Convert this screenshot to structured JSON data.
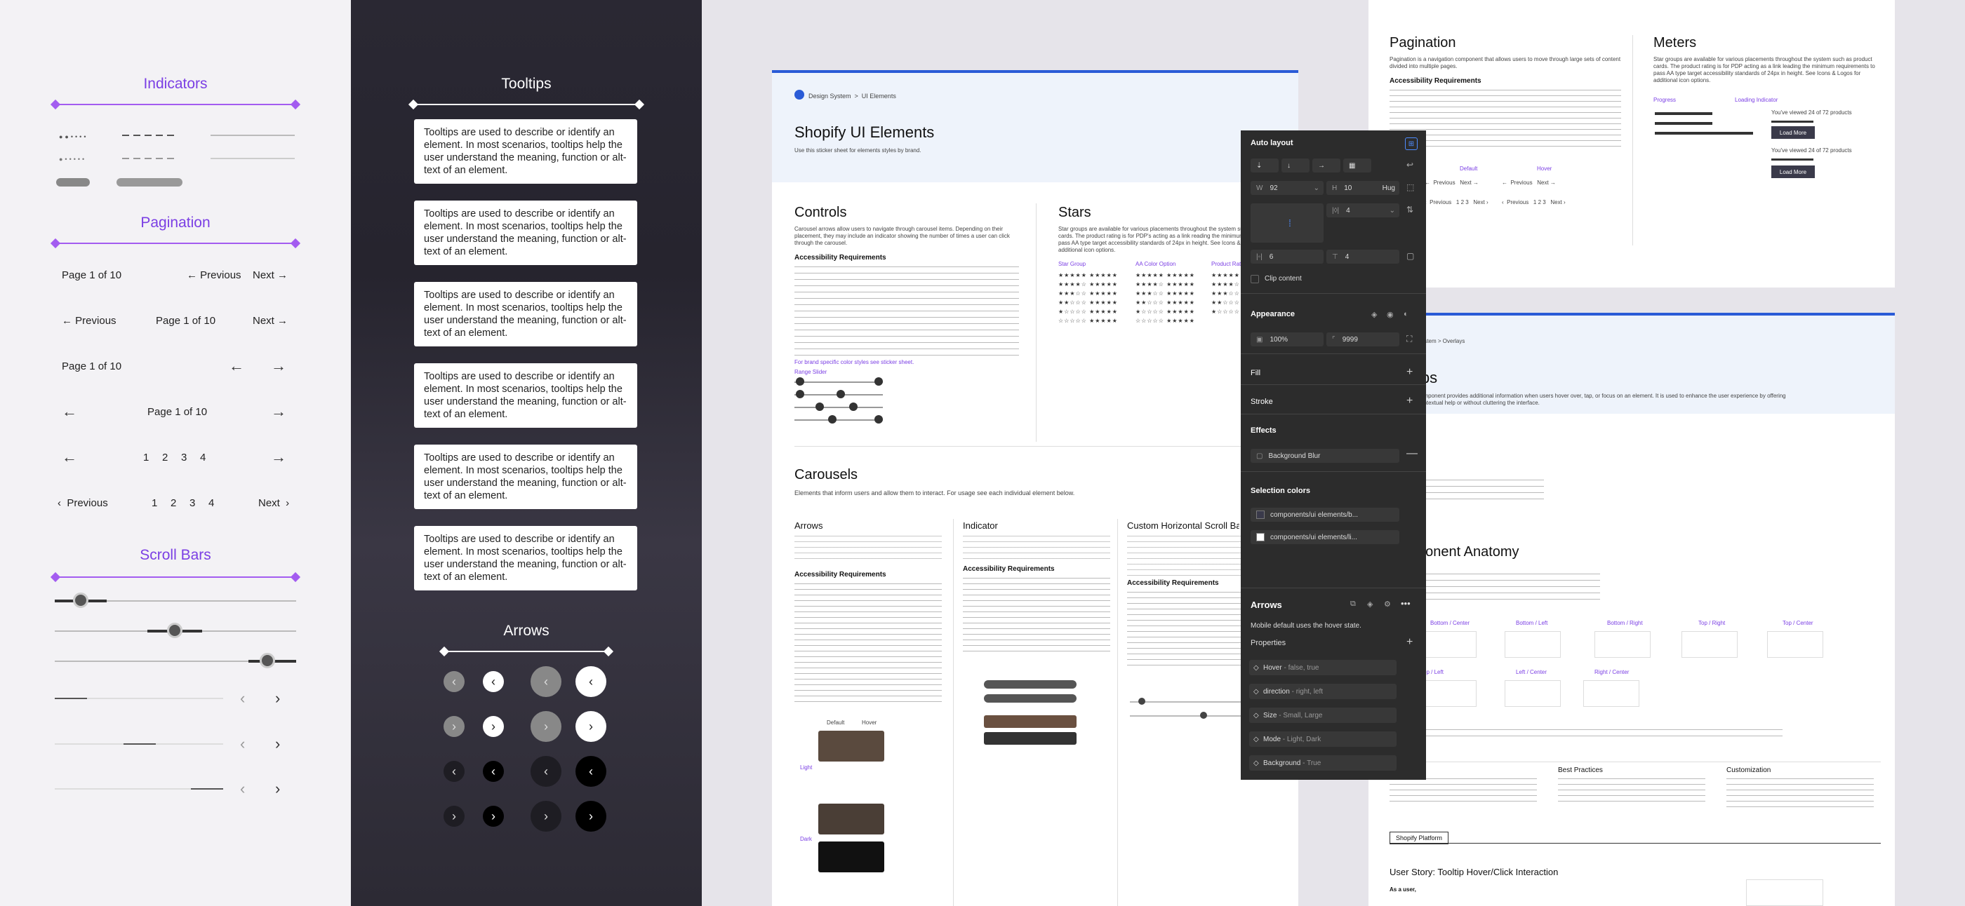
{
  "left": {
    "indicators_title": "Indicators",
    "pagination_title": "Pagination",
    "scrollbars_title": "Scroll Bars",
    "pagination": {
      "page_label": "Page 1 of 10",
      "previous": "Previous",
      "next": "Next",
      "numbers": [
        "1",
        "2",
        "3",
        "4"
      ]
    }
  },
  "middle": {
    "tooltips_title": "Tooltips",
    "tooltip_text": "Tooltips are used to describe or identify an element. In most scenarios, tooltips help the user understand the meaning, function or alt-text of an element.",
    "arrows_title": "Arrows"
  },
  "doc": {
    "breadcrumb_root": "Design System",
    "breadcrumb_leaf": "UI Elements",
    "title": "Shopify UI Elements",
    "subtitle": "Use this sticker sheet for elements styles by brand.",
    "controls_title": "Controls",
    "controls_desc": "Carousel arrows allow users to navigate through carousel items. Depending on their placement, they may include an indicator showing the number of times a user can click through the carousel.",
    "accessibility": "Accessibility Requirements",
    "stars_title": "Stars",
    "stars_desc": "Star groups are available for various placements throughout the system such as product cards. The product rating is for PDP's acting as a link reading the minimum requirements to pass AA type target accessibility standards of 24px in height. See Icons & Logos for additional icon options.",
    "carousels_title": "Carousels",
    "carousels_desc": "Elements that inform users and allow them to interact. For usage see each individual element below.",
    "arrows_col": "Arrows",
    "indicator_col": "Indicator",
    "custom_col": "Custom Horizontal Scroll Bar",
    "brand_link": "For brand specific color styles see sticker sheet.",
    "range_slider": "Range Slider",
    "star_group": "Star Group",
    "aa_color": "AA Color Option",
    "product_rating": "Product Rating",
    "default_label": "Default",
    "hover_label": "Hover",
    "light_label": "Light",
    "dark_label": "Dark"
  },
  "topright": {
    "pagination_title": "Pagination",
    "pagination_desc": "Pagination is a navigation component that allows users to move through large sets of content divided into multiple pages.",
    "accessibility": "Accessibility Requirements",
    "meters_title": "Meters",
    "meters_desc": "Star groups are available for various placements throughout the system such as product cards. The product rating is for PDP acting as a link leading the minimum requirements to pass AA type target accessibility standards of 24px in height. See Icons & Logos for additional icon options.",
    "progress": "Progress",
    "loading_indicator": "Loading Indicator",
    "viewed": "You've viewed 24 of 72 products",
    "load_more": "Load More",
    "default": "Default",
    "hover": "Hover",
    "previous": "Previous",
    "next": "Next"
  },
  "tooltipdoc": {
    "breadcrumb": "System  >  Overlays",
    "title_fragment": "ips",
    "desc": "component provides additional information when users hover over, tap, or focus on an element. It is used to enhance the user experience by offering contextual help or without cluttering the interface.",
    "usage_fragment": "e",
    "anatomy_title": "ponent Anatomy",
    "positions": [
      "Bottom / Center",
      "Bottom / Left",
      "Bottom / Right",
      "Top / Right",
      "Top / Center",
      "Top / Left",
      "Left / Center",
      "Right / Center"
    ],
    "accessibility": "ility",
    "best_practices": "Best Practices",
    "customization": "Customization",
    "platform_tab": "Shopify Platform",
    "user_story": "User Story: Tooltip Hover/Click Interaction",
    "as_a_user": "As a user,"
  },
  "panel": {
    "auto_layout": "Auto layout",
    "w_label": "W",
    "w_value": "92",
    "h_label": "H",
    "h_value": "10",
    "hug": "Hug",
    "gap": "4",
    "pad_h": "6",
    "pad_v": "4",
    "clip": "Clip content",
    "appearance": "Appearance",
    "opacity": "100%",
    "radius": "9999",
    "fill": "Fill",
    "stroke": "Stroke",
    "effects": "Effects",
    "blur": "Background Blur",
    "selection_colors": "Selection colors",
    "color1": "components/ui elements/b...",
    "color2": "components/ui elements/li..."
  },
  "props_panel": {
    "title": "Arrows",
    "desc": "Mobile default uses the hover state.",
    "properties": "Properties",
    "items": [
      {
        "name": "Hover",
        "value": "- false, true"
      },
      {
        "name": "direction",
        "value": "- right, left"
      },
      {
        "name": "Size",
        "value": "- Small, Large"
      },
      {
        "name": "Mode",
        "value": "- Light, Dark"
      },
      {
        "name": "Background",
        "value": "- True"
      }
    ]
  },
  "colors": {
    "accent": "#7b3fe4",
    "panel": "#2c2c2c",
    "blue": "#2a5bd7"
  }
}
